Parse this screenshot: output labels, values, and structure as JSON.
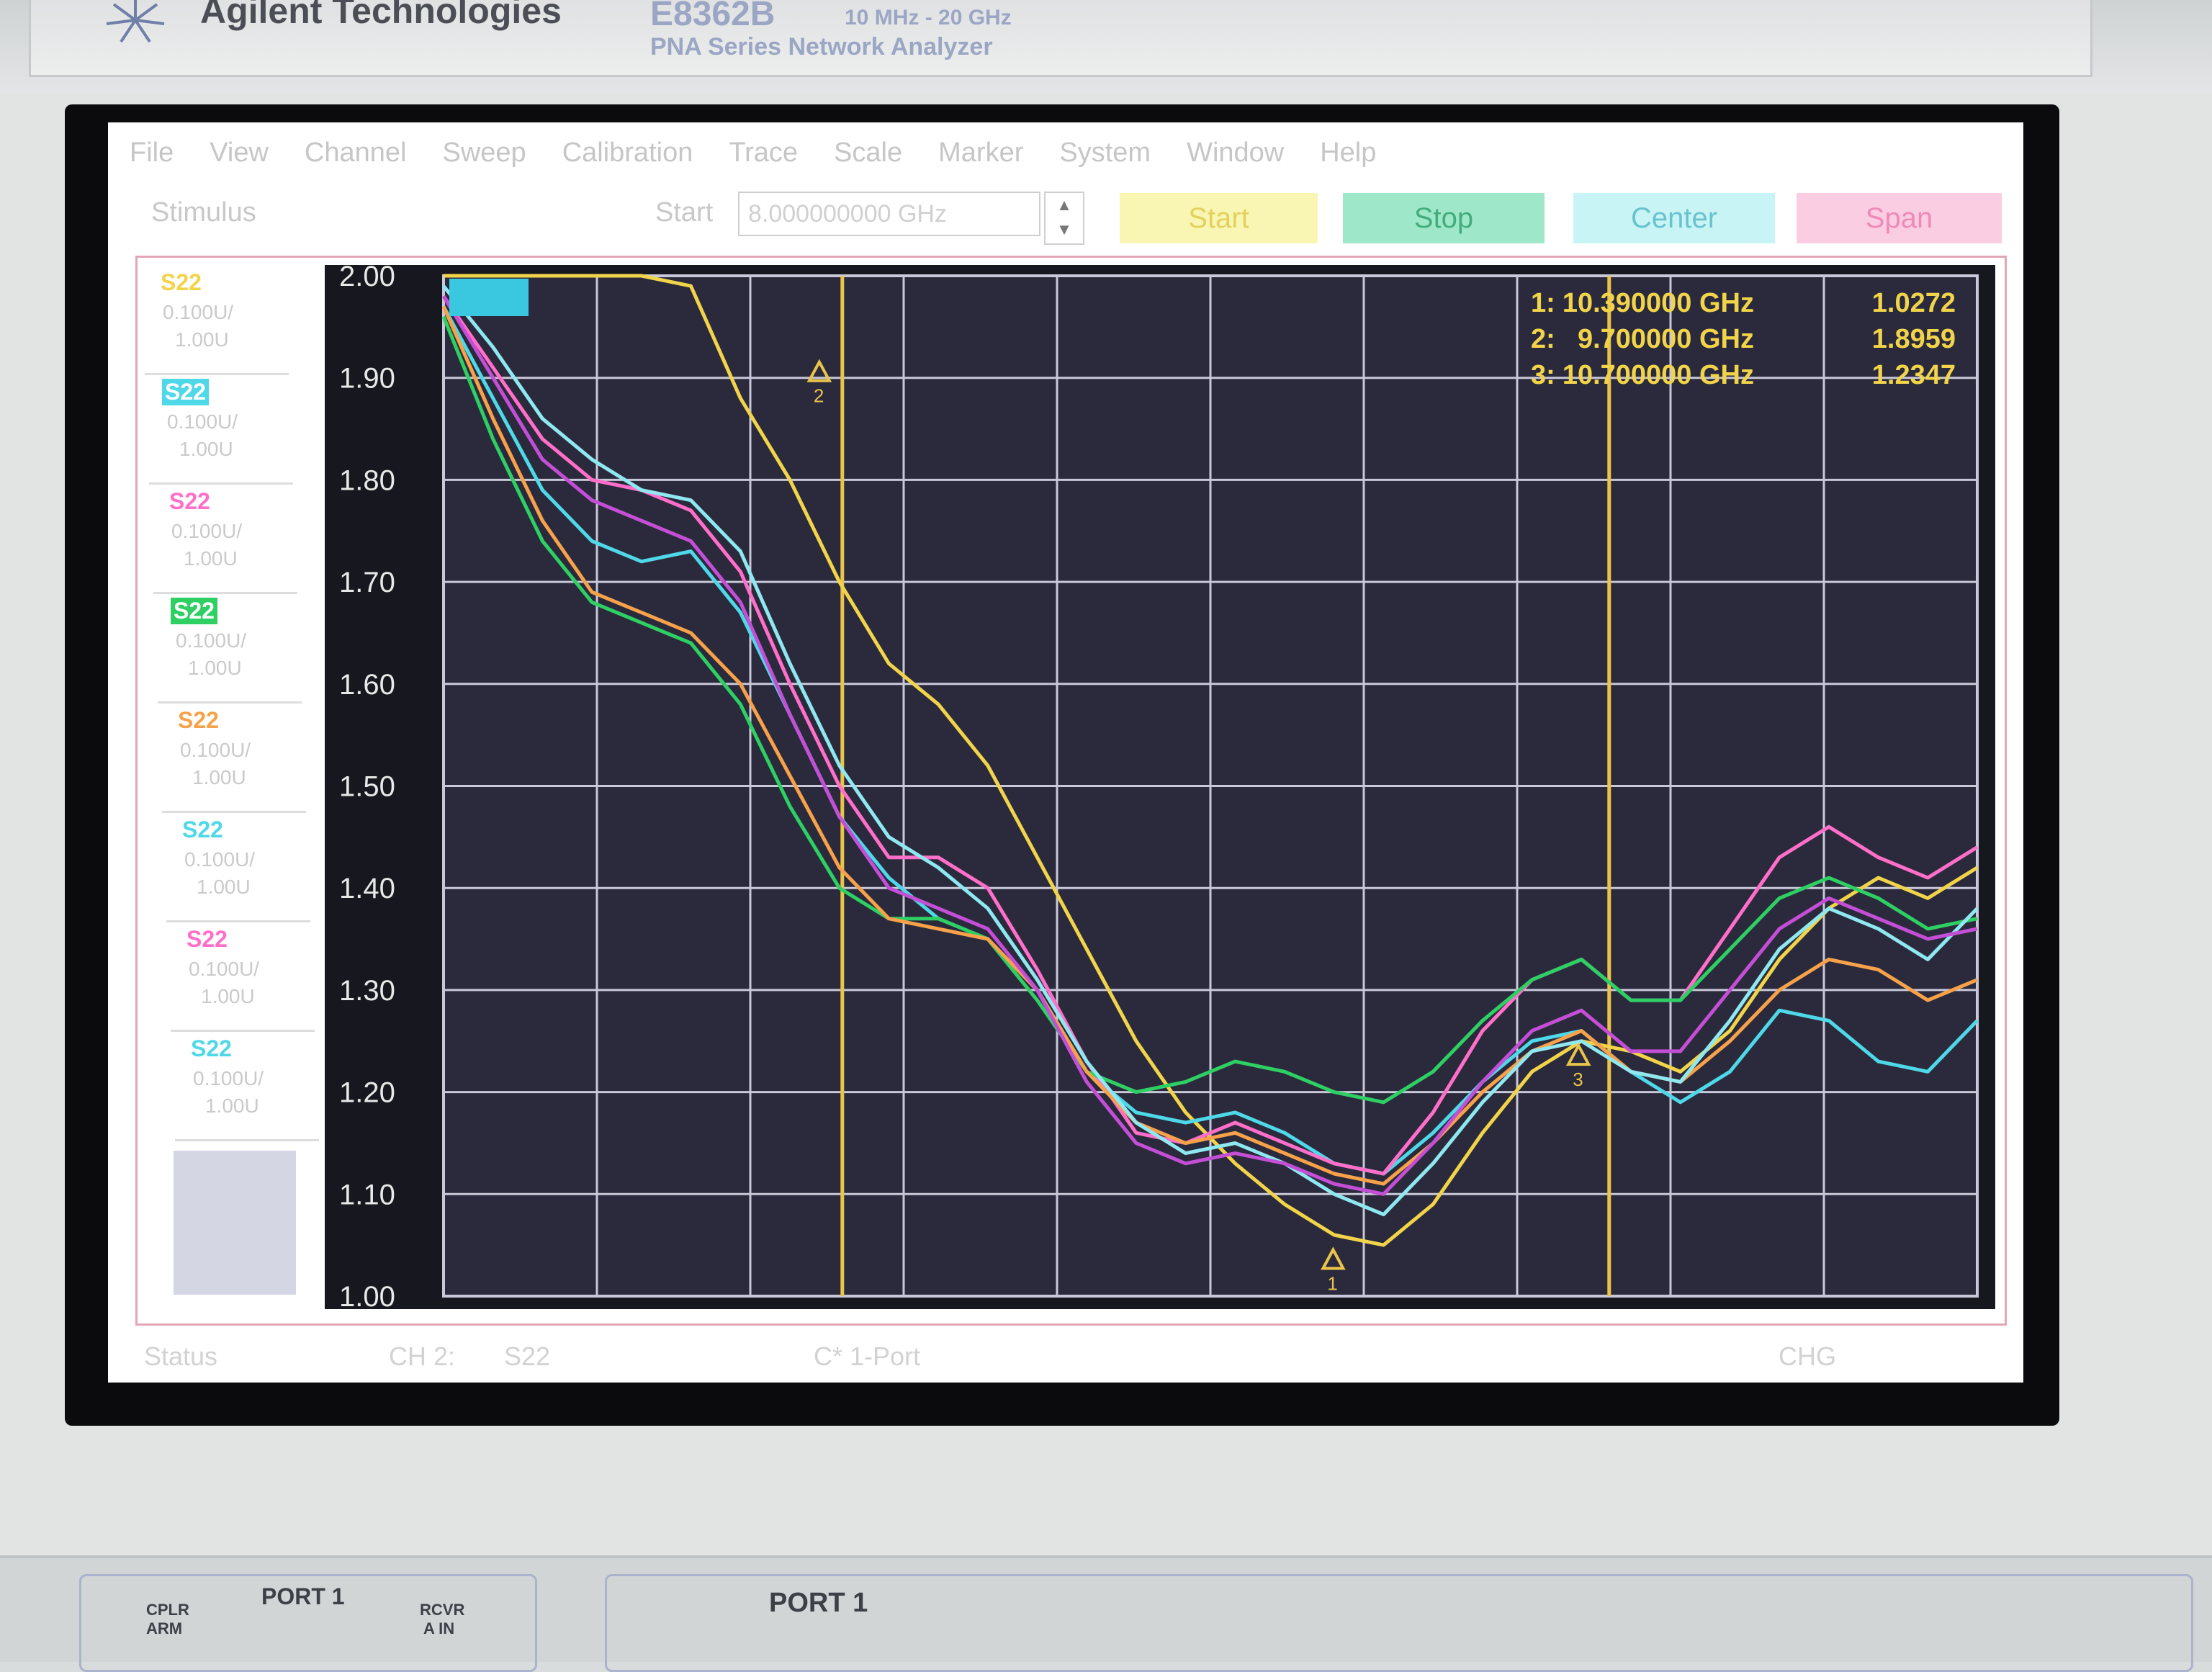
{
  "instrument": {
    "brand": "Agilent Technologies",
    "model": "E8362B",
    "range": "10 MHz - 20 GHz",
    "series": "PNA Series Network Analyzer"
  },
  "menu": [
    "File",
    "View",
    "Channel",
    "Sweep",
    "Calibration",
    "Trace",
    "Scale",
    "Marker",
    "System",
    "Window",
    "Help"
  ],
  "toolbar": {
    "stimulus": "Stimulus",
    "start_label": "Start",
    "start_value": "8.000000000 GHz",
    "buttons": {
      "start": "Start",
      "stop": "Stop",
      "center": "Center",
      "span": "Span"
    }
  },
  "traces": [
    {
      "name": "S22",
      "scale": "0.100U/",
      "ref": "1.00U",
      "color": "#f2d44a"
    },
    {
      "name": "S22",
      "scale": "0.100U/",
      "ref": "1.00U",
      "color": "#4fd8e8"
    },
    {
      "name": "S22",
      "scale": "0.100U/",
      "ref": "1.00U",
      "color": "#ff6fc9"
    },
    {
      "name": "S22",
      "scale": "0.100U/",
      "ref": "1.00U",
      "color": "#2ecf63"
    },
    {
      "name": "S22",
      "scale": "0.100U/",
      "ref": "1.00U",
      "color": "#f7a24a"
    },
    {
      "name": "S22",
      "scale": "0.100U/",
      "ref": "1.00U",
      "color": "#4fd8e8"
    },
    {
      "name": "S22",
      "scale": "0.100U/",
      "ref": "1.00U",
      "color": "#ff6fc9"
    },
    {
      "name": "S22",
      "scale": "0.100U/",
      "ref": "1.00U",
      "color": "#4fd8e8"
    }
  ],
  "markers": [
    {
      "id": "1:",
      "freq": "10.390000 GHz",
      "value": "1.0272"
    },
    {
      "id": "2:",
      "freq": "9.700000 GHz",
      "value": "1.8959"
    },
    {
      "id": "3:",
      "freq": "10.700000 GHz",
      "value": "1.2347"
    }
  ],
  "status": {
    "status": "Status",
    "channel": "CH 2:",
    "param": "S22",
    "port": "C* 1-Port",
    "chg": "CHG"
  },
  "front_panel": {
    "port_left": "PORT 1",
    "cplr": "CPLR",
    "arm": "ARM",
    "rcvr": "RCVR",
    "in": "A IN",
    "port_right": "PORT 1"
  },
  "chart_data": {
    "type": "line",
    "ylim": [
      1.0,
      2.0
    ],
    "yticks": [
      "2.00",
      "1.90",
      "1.80",
      "1.70",
      "1.60",
      "1.50",
      "1.40",
      "1.30",
      "1.20",
      "1.10",
      "1.00"
    ],
    "x_divisions": 10,
    "series": [
      {
        "color": "#f2d44a",
        "values": [
          2.0,
          2.0,
          2.0,
          2.0,
          2.0,
          1.99,
          1.88,
          1.8,
          1.7,
          1.62,
          1.58,
          1.52,
          1.43,
          1.34,
          1.25,
          1.18,
          1.13,
          1.09,
          1.06,
          1.05,
          1.09,
          1.16,
          1.22,
          1.25,
          1.24,
          1.22,
          1.26,
          1.33,
          1.38,
          1.41,
          1.39,
          1.42
        ]
      },
      {
        "color": "#4fd8e8",
        "values": [
          1.97,
          1.88,
          1.79,
          1.74,
          1.72,
          1.73,
          1.67,
          1.57,
          1.47,
          1.41,
          1.37,
          1.35,
          1.3,
          1.22,
          1.18,
          1.17,
          1.18,
          1.16,
          1.13,
          1.12,
          1.16,
          1.21,
          1.25,
          1.26,
          1.22,
          1.19,
          1.22,
          1.28,
          1.27,
          1.23,
          1.22,
          1.27
        ]
      },
      {
        "color": "#ff6fc9",
        "values": [
          1.98,
          1.91,
          1.84,
          1.8,
          1.79,
          1.77,
          1.71,
          1.6,
          1.5,
          1.43,
          1.43,
          1.4,
          1.32,
          1.23,
          1.16,
          1.15,
          1.17,
          1.15,
          1.13,
          1.12,
          1.18,
          1.26,
          1.31,
          1.33,
          1.29,
          1.29,
          1.36,
          1.43,
          1.46,
          1.43,
          1.41,
          1.44
        ]
      },
      {
        "color": "#2ecf63",
        "values": [
          1.96,
          1.84,
          1.74,
          1.68,
          1.66,
          1.64,
          1.58,
          1.48,
          1.4,
          1.37,
          1.37,
          1.35,
          1.29,
          1.22,
          1.2,
          1.21,
          1.23,
          1.22,
          1.2,
          1.19,
          1.22,
          1.27,
          1.31,
          1.33,
          1.29,
          1.29,
          1.34,
          1.39,
          1.41,
          1.39,
          1.36,
          1.37
        ]
      },
      {
        "color": "#f7a24a",
        "values": [
          1.97,
          1.86,
          1.76,
          1.69,
          1.67,
          1.65,
          1.6,
          1.51,
          1.42,
          1.37,
          1.36,
          1.35,
          1.3,
          1.22,
          1.17,
          1.15,
          1.16,
          1.14,
          1.12,
          1.11,
          1.15,
          1.2,
          1.24,
          1.26,
          1.22,
          1.21,
          1.25,
          1.3,
          1.33,
          1.32,
          1.29,
          1.31
        ]
      },
      {
        "color": "#8fe8f0",
        "values": [
          1.99,
          1.93,
          1.86,
          1.82,
          1.79,
          1.78,
          1.73,
          1.62,
          1.52,
          1.45,
          1.42,
          1.38,
          1.31,
          1.23,
          1.17,
          1.14,
          1.15,
          1.13,
          1.1,
          1.08,
          1.13,
          1.19,
          1.24,
          1.25,
          1.22,
          1.21,
          1.27,
          1.34,
          1.38,
          1.36,
          1.33,
          1.38
        ]
      },
      {
        "color": "#c44fd6",
        "values": [
          1.98,
          1.9,
          1.82,
          1.78,
          1.76,
          1.74,
          1.68,
          1.57,
          1.47,
          1.4,
          1.38,
          1.36,
          1.3,
          1.21,
          1.15,
          1.13,
          1.14,
          1.13,
          1.11,
          1.1,
          1.15,
          1.21,
          1.26,
          1.28,
          1.24,
          1.24,
          1.3,
          1.36,
          1.39,
          1.37,
          1.35,
          1.36
        ]
      }
    ],
    "markers": [
      {
        "id": "1",
        "x_frac": 0.58,
        "y": 1.03
      },
      {
        "id": "2",
        "x_frac": 0.245,
        "y": 1.9
      },
      {
        "id": "3",
        "x_frac": 0.74,
        "y": 1.23
      }
    ],
    "limit_lines_x_frac": [
      0.26,
      0.76
    ]
  }
}
